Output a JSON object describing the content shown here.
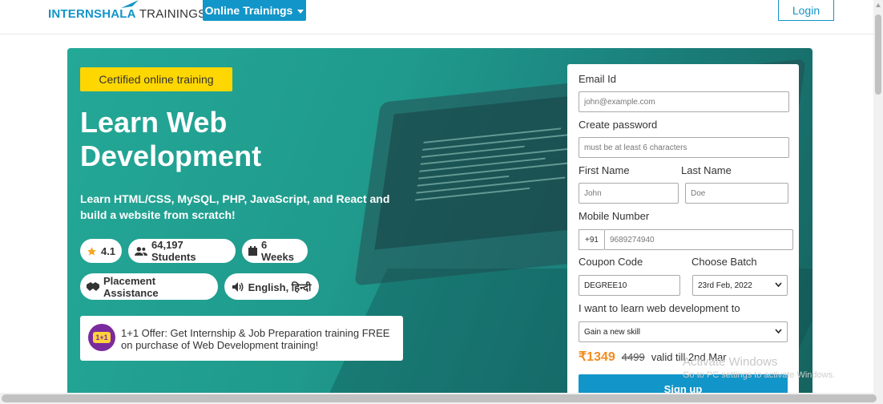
{
  "header": {
    "logo_brand": "INTERNSHALA",
    "logo_sub": "TRAININGS",
    "online_trainings_label": "Online Trainings",
    "login_label": "Login",
    "brand_color": "#1295c9"
  },
  "hero": {
    "badge": "Certified online training",
    "title_line1": "Learn Web",
    "title_line2": "Development",
    "subtitle": "Learn HTML/CSS, MySQL, PHP, JavaScript, and React and build a website from scratch!",
    "stats": {
      "rating": "4.1",
      "students": "64,197 Students",
      "duration": "6 Weeks",
      "placement": "Placement Assistance",
      "language": "English, हिन्दी"
    },
    "offer_badge": "1+1",
    "offer_text": "1+1 Offer: Get Internship & Job Preparation training FREE on purchase of Web Development training!"
  },
  "form": {
    "email_label": "Email Id",
    "email_placeholder": "john@example.com",
    "password_label": "Create password",
    "password_placeholder": "must be at least 6 characters",
    "first_name_label": "First Name",
    "first_name_placeholder": "John",
    "last_name_label": "Last Name",
    "last_name_placeholder": "Doe",
    "mobile_label": "Mobile Number",
    "mobile_prefix": "+91",
    "mobile_placeholder": "9689274940",
    "coupon_label": "Coupon Code",
    "coupon_value": "DEGREE10",
    "batch_label": "Choose Batch",
    "batch_value": "23rd Feb, 2022",
    "goal_label": "I want to learn web development to",
    "goal_value": "Gain a new skill",
    "price_now": "₹1349",
    "price_was": "4499",
    "price_valid": "valid till 2nd Mar",
    "signup_label": "Sign up"
  },
  "watermark": {
    "line1": "Activate Windows",
    "line2": "Go to PC settings to activate Windows."
  }
}
